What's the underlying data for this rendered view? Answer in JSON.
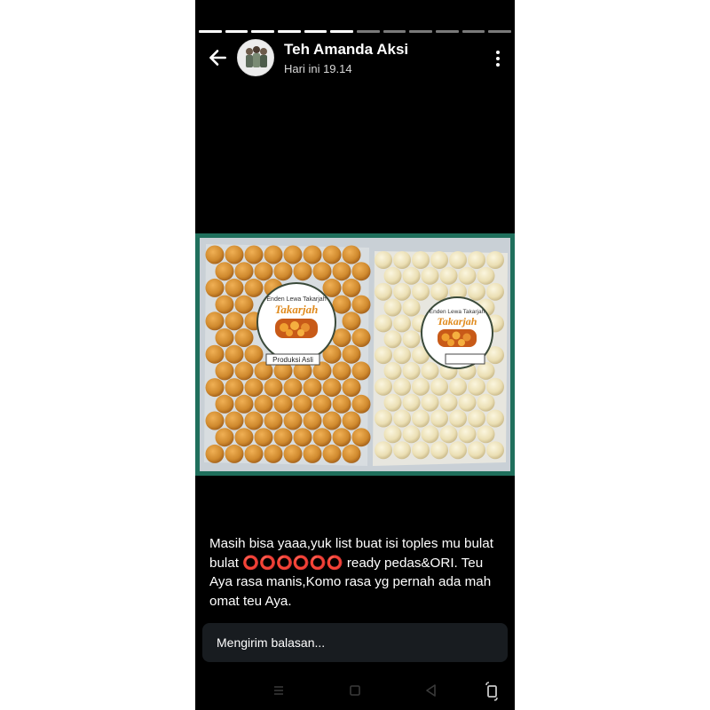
{
  "story": {
    "contact_name": "Teh Amanda Aksi",
    "timestamp": "Hari ini 19.14",
    "segments_total": 12,
    "segments_viewed": 6,
    "caption": "Masih bisa yaaa,yuk list buat isi toples mu bulat bulat ⭕⭕⭕⭕⭕⭕ ready pedas&ORI. Teu Aya rasa manis,Komo rasa yg pernah ada mah omat teu Aya.",
    "reply_placeholder": "Mengirim balasan..."
  },
  "photo": {
    "label_brand": "Takarjah",
    "label_arc": "Enden Lewa Takarjah",
    "label_bottom": "Produksi Asli"
  },
  "icons": {
    "back": "arrow-left-icon",
    "menu": "more-vertical-icon",
    "nav_menu": "menu-icon",
    "nav_home": "square-icon",
    "nav_back": "triangle-back-icon",
    "nav_rotate": "rotate-icon"
  },
  "colors": {
    "background": "#000000",
    "progress_viewed": "#ffffff",
    "progress_pending": "#7a7a7a",
    "photo_frame": "#1f6f5c",
    "reply_bg": "#181c20"
  }
}
